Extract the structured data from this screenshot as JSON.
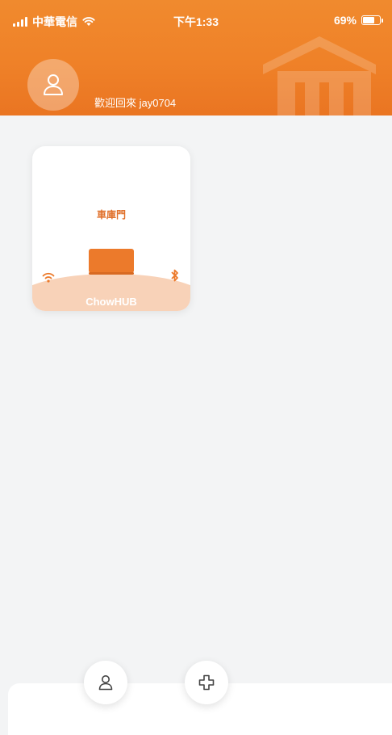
{
  "status_bar": {
    "carrier": "中華電信",
    "time": "下午1:33",
    "battery": "69%",
    "battery_level": 0.69
  },
  "header": {
    "welcome_text": "歡迎回來 jay0704",
    "avatar_icon": "user-icon",
    "watermark": "house-logo"
  },
  "devices": [
    {
      "name": "車庫門",
      "brand": "ChowHUB",
      "icons": [
        "wifi-icon",
        "bluetooth-icon"
      ]
    }
  ],
  "bottom_nav": {
    "profile_icon": "user-icon",
    "add_icon": "plus-icon"
  },
  "colors": {
    "primary": "#ef8128",
    "card_base": "#f8d2b8",
    "background": "#f3f4f5"
  }
}
